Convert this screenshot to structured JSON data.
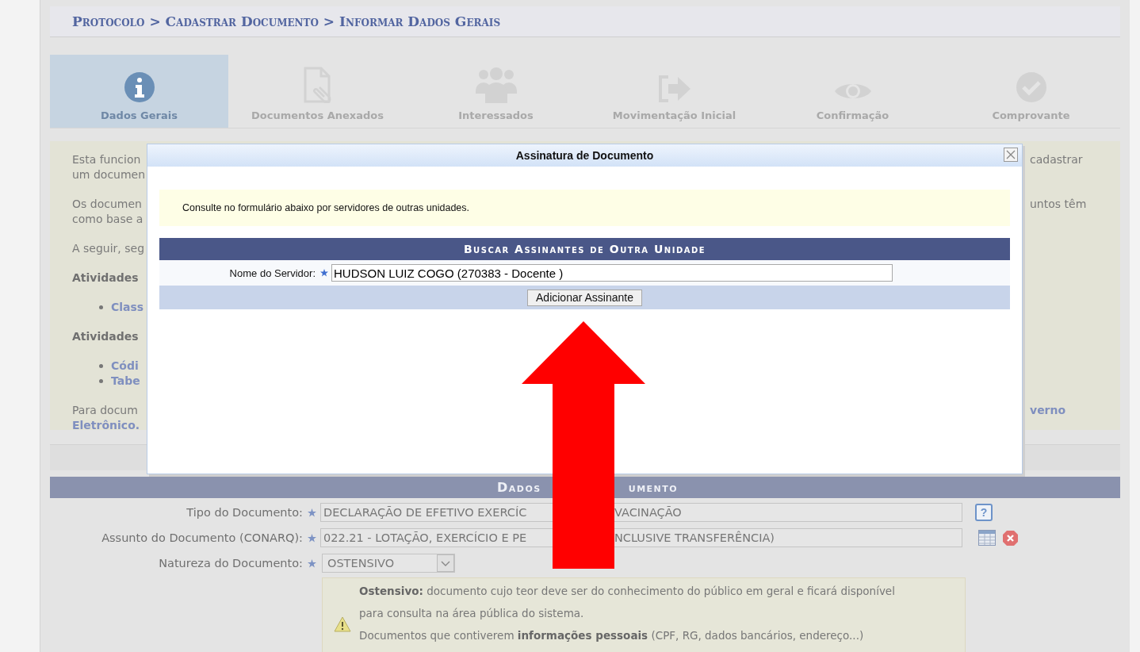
{
  "breadcrumb": {
    "items": [
      "Protocolo",
      "Cadastrar Documento",
      "Informar Dados Gerais"
    ],
    "separator": ">"
  },
  "steps": [
    {
      "label": "Dados Gerais",
      "kind": "info",
      "selected": true
    },
    {
      "label": "Documentos Anexados",
      "kind": "attachment",
      "selected": false
    },
    {
      "label": "Interessados",
      "kind": "people",
      "selected": false
    },
    {
      "label": "Movimentação Inicial",
      "kind": "forward",
      "selected": false
    },
    {
      "label": "Confirmação",
      "kind": "eye",
      "selected": false
    },
    {
      "label": "Comprovante",
      "kind": "check",
      "selected": false
    }
  ],
  "info_panel": {
    "paragraphs": [
      {
        "kind": "text",
        "lines": [
          {
            "left": {
              "text": "Esta funcion",
              "kind": "text"
            },
            "right": {
              "text": "cadastrar",
              "kind": "text"
            }
          },
          {
            "left": {
              "text": "um documen",
              "kind": "text"
            }
          }
        ]
      },
      {
        "kind": "text",
        "lines": [
          {
            "left": {
              "text": "Os documen",
              "kind": "text"
            },
            "right": {
              "text": "untos têm",
              "kind": "text"
            }
          },
          {
            "left": {
              "text": "como base a",
              "kind": "text"
            }
          }
        ]
      },
      {
        "kind": "text",
        "lines": [
          {
            "left": {
              "text": "A seguir, seg",
              "kind": "text"
            }
          }
        ]
      },
      {
        "kind": "heading",
        "lines": [
          {
            "left": {
              "text": "Atividades",
              "kind": "text"
            }
          }
        ]
      },
      {
        "kind": "bullets",
        "lines": [
          {
            "left": {
              "text": "Class",
              "kind": "link"
            }
          }
        ]
      },
      {
        "kind": "heading",
        "lines": [
          {
            "left": {
              "text": "Atividades",
              "kind": "text"
            }
          }
        ]
      },
      {
        "kind": "bullets",
        "lines": [
          {
            "left": {
              "text": "Códi",
              "kind": "link"
            }
          },
          {
            "left": {
              "text": "Tabe",
              "kind": "link"
            }
          }
        ]
      },
      {
        "kind": "text",
        "lines": [
          {
            "left": {
              "text": "Para docum",
              "kind": "text"
            },
            "right": {
              "text": "verno",
              "kind": "link"
            }
          },
          {
            "left": {
              "text": "Eletrônico.",
              "kind": "link"
            }
          }
        ]
      }
    ]
  },
  "document_section": {
    "title_parts": [
      "Dados",
      "umento"
    ],
    "fields": [
      {
        "label": "Tipo do Documento:",
        "required": true,
        "kind": "text-help",
        "help_text": "?",
        "value_parts": [
          "DECLARAÇÃO DE EFETIVO EXERCÍC",
          "VACINAÇÃO"
        ]
      },
      {
        "label": "Assunto do Documento (CONARQ):",
        "required": true,
        "kind": "text-lookup",
        "value_parts": [
          "022.21 - LOTAÇÃO, EXERCÍCIO E PE",
          "NCLUSIVE TRANSFERÊNCIA)"
        ]
      },
      {
        "label": "Natureza do Documento:",
        "required": true,
        "kind": "select",
        "value_parts": [
          "OSTENSIVO"
        ]
      }
    ],
    "warning": [
      "**Ostensivo:** documento cujo teor deve ser do conhecimento do público em geral e ficará disponível",
      "para consulta na área pública do sistema.",
      "Documentos que contiverem **informações pessoais** (CPF, RG, dados bancários, endereço...)"
    ]
  },
  "dialog": {
    "title": "Assinatura de Documento",
    "note": "Consulte no formulário abaixo por servidores de outras unidades.",
    "form_title": "Buscar Assinantes de Outra Unidade",
    "field_label": "Nome do Servidor:",
    "required": true,
    "field_value": "HUDSON LUIZ COGO (270383 - Docente )",
    "button": "Adicionar Assinante"
  }
}
